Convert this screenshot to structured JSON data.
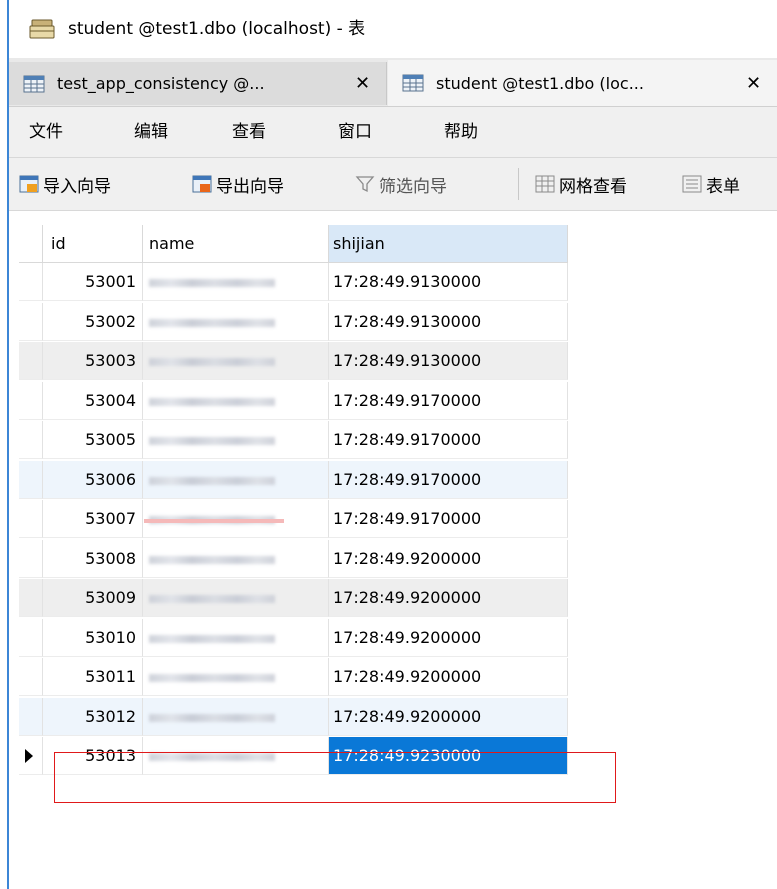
{
  "window": {
    "title": "student @test1.dbo (localhost) - 表",
    "title_icon": "table-window-icon"
  },
  "tabs": [
    {
      "label": "test_app_consistency @...",
      "close": "✕",
      "icon": "table-grid-icon",
      "active": false
    },
    {
      "label": "student @test1.dbo (loc...",
      "close": "✕",
      "icon": "table-grid-icon",
      "active": true
    }
  ],
  "menu": {
    "items": [
      "文件",
      "编辑",
      "查看",
      "窗口",
      "帮助"
    ]
  },
  "toolbar": {
    "import_label": "导入向导",
    "export_label": "导出向导",
    "filter_label": "筛选向导",
    "grid_view_label": "网格查看",
    "form_view_label": "表单"
  },
  "grid": {
    "columns": [
      "id",
      "name",
      "shijian"
    ],
    "rows": [
      {
        "id": "53001",
        "shijian": "17:28:49.9130000"
      },
      {
        "id": "53002",
        "shijian": "17:28:49.9130000"
      },
      {
        "id": "53003",
        "shijian": "17:28:49.9130000"
      },
      {
        "id": "53004",
        "shijian": "17:28:49.9170000"
      },
      {
        "id": "53005",
        "shijian": "17:28:49.9170000"
      },
      {
        "id": "53006",
        "shijian": "17:28:49.9170000"
      },
      {
        "id": "53007",
        "shijian": "17:28:49.9170000"
      },
      {
        "id": "53008",
        "shijian": "17:28:49.9200000"
      },
      {
        "id": "53009",
        "shijian": "17:28:49.9200000"
      },
      {
        "id": "53010",
        "shijian": "17:28:49.9200000"
      },
      {
        "id": "53011",
        "shijian": "17:28:49.9200000"
      },
      {
        "id": "53012",
        "shijian": "17:28:49.9200000"
      },
      {
        "id": "53013",
        "shijian": "17:28:49.9230000"
      }
    ]
  },
  "colors": {
    "selection": "#0a78d7",
    "highlight_box": "#e0191a",
    "header_selected": "#d9e8f7"
  }
}
